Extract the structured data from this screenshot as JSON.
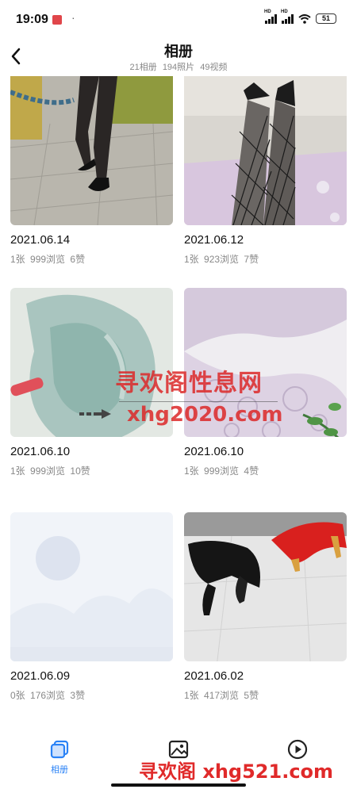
{
  "status_bar": {
    "time": "19:09",
    "battery": "51",
    "net1": "HD",
    "net2": "HD"
  },
  "header": {
    "title": "相册",
    "stats": [
      "21相册",
      "194照片",
      "49视频"
    ]
  },
  "albums": [
    {
      "date": "2021.06.14",
      "count": "1张",
      "views": "999浏览",
      "likes": "6赞",
      "thumb": "heels-pavement"
    },
    {
      "date": "2021.06.12",
      "count": "1张",
      "views": "923浏览",
      "likes": "7赞",
      "thumb": "fishnet-legs"
    },
    {
      "date": "2021.06.10",
      "count": "1张",
      "views": "999浏览",
      "likes": "10赞",
      "thumb": "green-fabric"
    },
    {
      "date": "2021.06.10",
      "count": "1张",
      "views": "999浏览",
      "likes": "4赞",
      "thumb": "lace-fabric"
    },
    {
      "date": "2021.06.09",
      "count": "0张",
      "views": "176浏览",
      "likes": "3赞",
      "thumb": "placeholder-image"
    },
    {
      "date": "2021.06.02",
      "count": "1张",
      "views": "417浏览",
      "likes": "5赞",
      "thumb": "heels-tiles"
    }
  ],
  "watermarks": {
    "line1": "寻欢阁性息网",
    "line2": "xhg2020.com",
    "footer": "寻欢阁 xhg521.com"
  },
  "tabs": [
    {
      "label": "相册",
      "icon": "album-icon",
      "active": true
    },
    {
      "label": "",
      "icon": "photo-icon",
      "active": false
    },
    {
      "label": "",
      "icon": "video-play-icon",
      "active": false
    }
  ],
  "colors": {
    "accent": "#2a82f6",
    "text_primary": "#111111",
    "text_secondary": "#888888",
    "watermark": "#e02a2a"
  }
}
